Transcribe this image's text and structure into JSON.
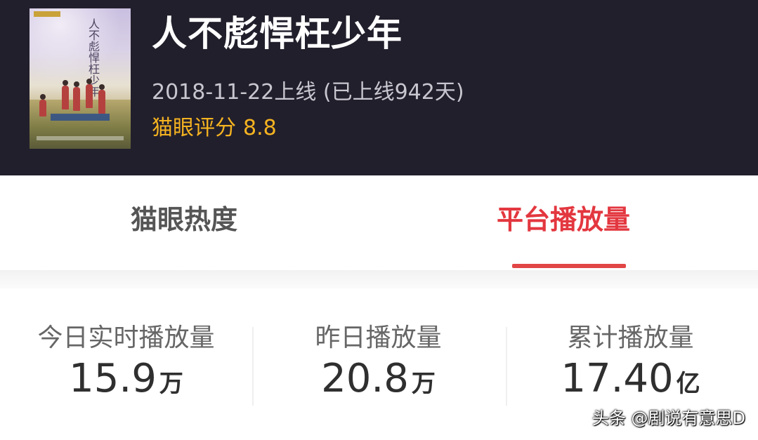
{
  "show": {
    "title": "人不彪悍枉少年",
    "release": "2018-11-22上线 (已上线942天)",
    "rating_label": "猫眼评分",
    "rating_value": "8.8",
    "poster_title": "人不彪悍枉少年"
  },
  "tabs": {
    "heat_label": "猫眼热度",
    "play_label": "平台播放量",
    "active": "平台播放量"
  },
  "stats": [
    {
      "label": "今日实时播放量",
      "value": "15.9",
      "unit": "万"
    },
    {
      "label": "昨日播放量",
      "value": "20.8",
      "unit": "万"
    },
    {
      "label": "累计播放量",
      "value": "17.40",
      "unit": "亿"
    }
  ],
  "watermark": "头条 @剧说有意思D",
  "colors": {
    "header_bg": "#221f2c",
    "rating": "#f5b320",
    "active_tab": "#e3373f"
  }
}
